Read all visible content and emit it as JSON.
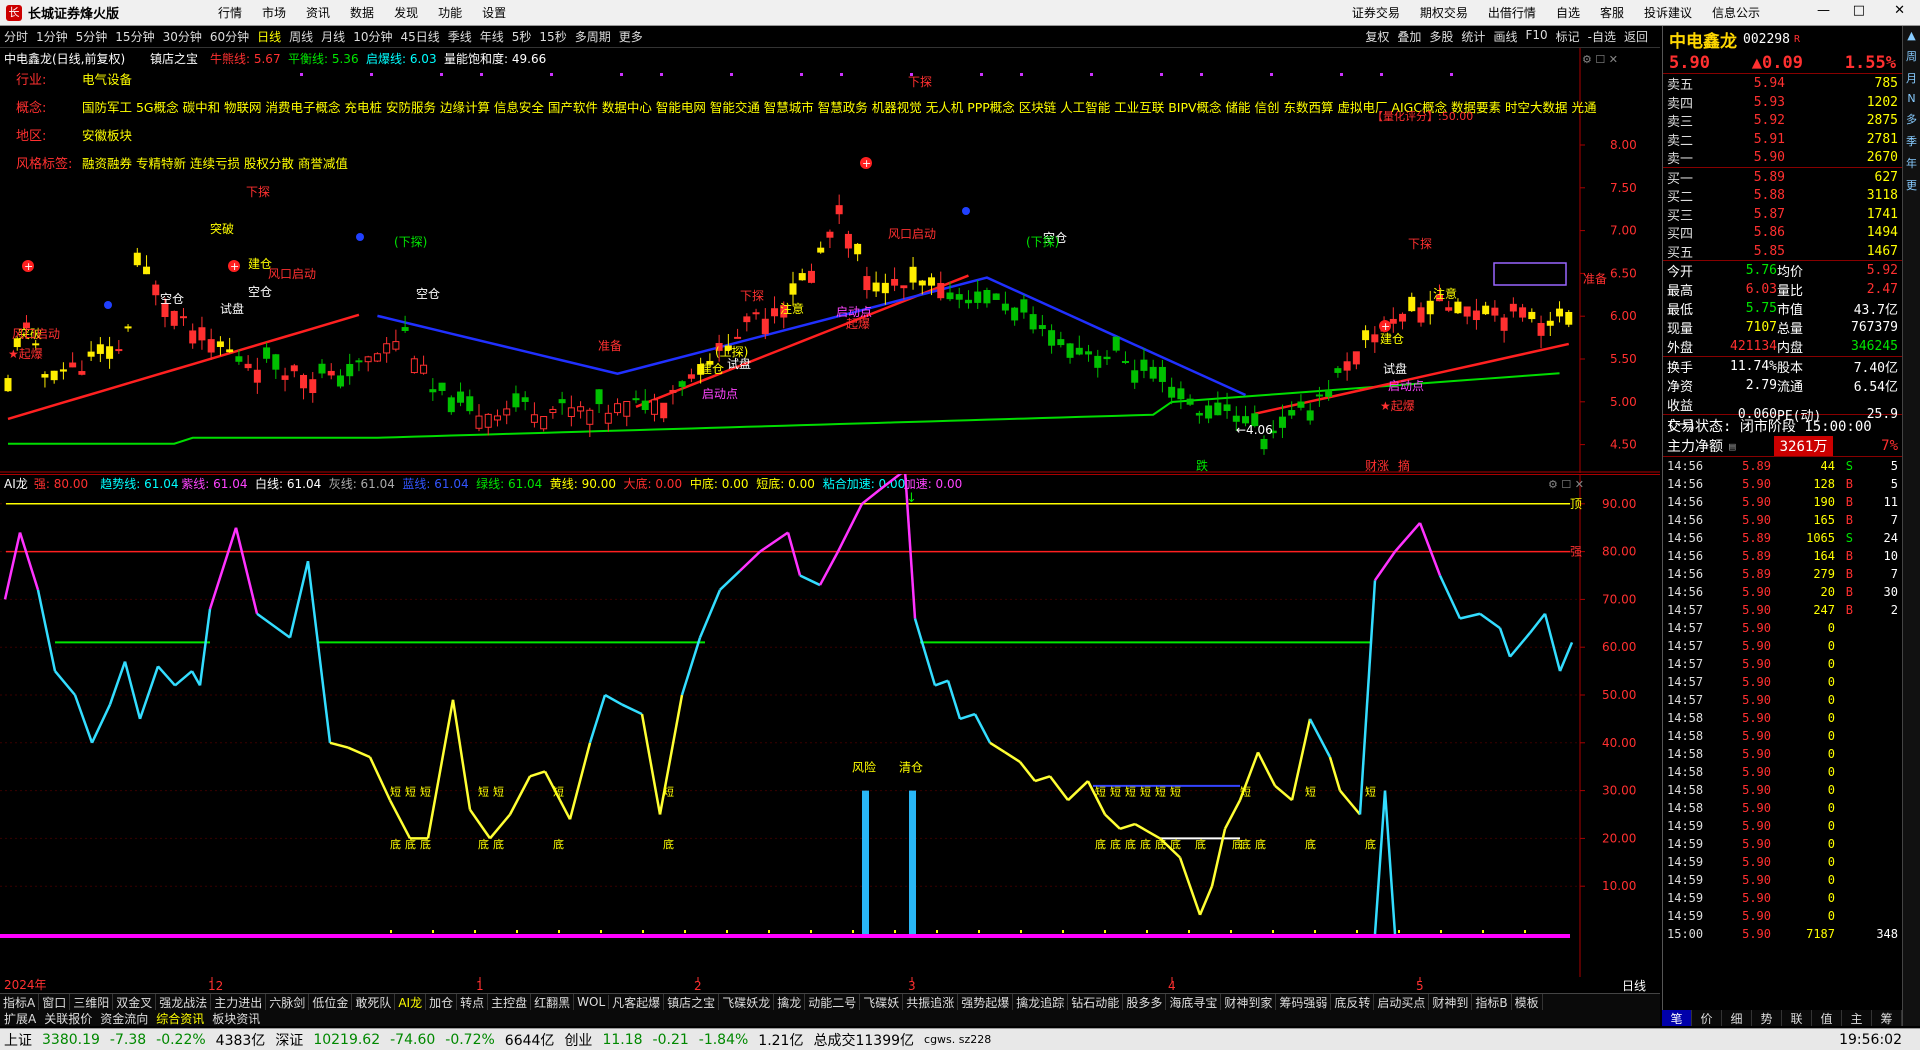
{
  "app": {
    "title": "长城证券烽火版",
    "menu": [
      "行情",
      "市场",
      "资讯",
      "数据",
      "发现",
      "功能",
      "设置"
    ],
    "right_menu": [
      "证券交易",
      "期权交易",
      "出借行情",
      "自选",
      "客服",
      "投诉建议",
      "信息公示"
    ]
  },
  "toolbar": {
    "periods": [
      "分时",
      "1分钟",
      "5分钟",
      "15分钟",
      "30分钟",
      "60分钟",
      "日线",
      "周线",
      "月线",
      "10分钟",
      "45日线",
      "季线",
      "年线",
      "5秒",
      "15秒",
      "多周期",
      "更多"
    ],
    "active": "日线",
    "right": [
      "复权",
      "叠加",
      "多股",
      "统计",
      "画线",
      "F10",
      "标记",
      "-自选",
      "返回"
    ]
  },
  "main_chart": {
    "header": {
      "name": "中电鑫龙(日线,前复权)",
      "indicator": "镇店之宝",
      "items": [
        {
          "t": "牛熊线: 5.67",
          "c": "#ff3030"
        },
        {
          "t": "平衡线: 5.36",
          "c": "#00e600"
        },
        {
          "t": "启爆线: 6.03",
          "c": "#00ffff"
        },
        {
          "t": "量能饱和度: 49.66",
          "c": "#ffffff"
        }
      ]
    },
    "info": [
      {
        "k": "行业:",
        "v": "电气设备"
      },
      {
        "k": "概念:",
        "v": "国防军工 5G概念 碳中和 物联网 消费电子概念 充电桩 安防服务 边缘计算 信息安全 国产软件 数据中心 智能电网 智能交通 智慧城市 智慧政务 机器视觉 无人机 PPP概念 区块链 人工智能 工业互联 BIPV概念 储能 信创 东数西算 虚拟电厂 AIGC概念 数据要素 时空大数据 光通"
      },
      {
        "k": "地区:",
        "v": "安徽板块"
      },
      {
        "k": "风格标签:",
        "v": "融资融券 专精特新 连续亏损 股权分散 商誉减值"
      }
    ],
    "y_ticks": [
      "8.00",
      "7.50",
      "7.00",
      "6.50",
      "6.00",
      "5.50",
      "5.00",
      "4.50",
      "4.00"
    ],
    "labels": {
      "low": "←4.06",
      "quant": "【量化评分】:50.00",
      "tags": [
        "跌",
        "财涨",
        "摘"
      ]
    },
    "markers": {
      "shikai": "空仓",
      "shipan": "试盘",
      "tupo": "突破",
      "xiatan": "下探",
      "jiancang": "建仓",
      "fengkou": "风口启动",
      "zhuyi": "注意",
      "qidong": "启动点",
      "shangtan": "(上探)",
      "xiatan2": "(下探)",
      "zhunbei": "准备",
      "qibao": "起爆",
      "qidian": "★起爆"
    }
  },
  "ai_chart": {
    "header": [
      {
        "t": "AI龙",
        "c": "#ffffff"
      },
      {
        "t": "强: 80.00",
        "c": "#ff3030"
      },
      {
        "t": "趋势线: 61.04",
        "c": "#00ffff"
      },
      {
        "t": "紫线: 61.04",
        "c": "#ff44ff"
      },
      {
        "t": "白线: 61.04",
        "c": "#ffffff"
      },
      {
        "t": "灰线: 61.04",
        "c": "#aaaaaa"
      },
      {
        "t": "蓝线: 61.04",
        "c": "#3355ff"
      },
      {
        "t": "绿线: 61.04",
        "c": "#00e600"
      },
      {
        "t": "黄线: 90.00",
        "c": "#ffff00"
      },
      {
        "t": "大底: 0.00",
        "c": "#ff3030"
      },
      {
        "t": "中底: 0.00",
        "c": "#ffff00"
      },
      {
        "t": "短底: 0.00",
        "c": "#ffff00"
      },
      {
        "t": "粘合加速: 0.00",
        "c": "#00ffff"
      },
      {
        "t": "加速: 0.00",
        "c": "#ff44ff"
      }
    ],
    "y_ticks": [
      "90.00",
      "80.00",
      "70.00",
      "60.00",
      "50.00",
      "40.00",
      "30.00",
      "20.00",
      "10.00"
    ],
    "line_labels": {
      "top": "顶",
      "strong": "强"
    },
    "events": {
      "risk": "风险",
      "clear": "清仓"
    },
    "di": "底",
    "duan": "短"
  },
  "x_axis": {
    "year": "2024年",
    "months": [
      "12",
      "1",
      "2",
      "3",
      "4",
      "5"
    ],
    "period": "日线"
  },
  "bottom_tabs": [
    "指标A",
    "窗口",
    "三维阳",
    "双金叉",
    "强龙战法",
    "主力进出",
    "六脉剑",
    "低位金",
    "敢死队",
    "AI龙",
    "加仓",
    "转点",
    "主控盘",
    "红翻黑",
    "WOL",
    "凡客起爆",
    "镇店之宝",
    "飞碟妖龙",
    "擒龙",
    "动能二号",
    "飞碟妖",
    "共振追涨",
    "强势起爆",
    "擒龙追踪",
    "钻石动能",
    "股多多",
    "海底寻宝",
    "财神到家",
    "筹码强弱",
    "底反转",
    "启动买点",
    "财神到",
    "指标B",
    "模板"
  ],
  "bottom_tabs_active": "AI龙",
  "bottom_tabs2": [
    "扩展A",
    "关联报价",
    "资金流向",
    "综合资讯",
    "板块资讯"
  ],
  "bottom_tabs2_active": "综合资讯",
  "quote": {
    "name": "中电鑫龙",
    "code": "002298",
    "flag": "R",
    "price": "5.90",
    "change": "▲0.09",
    "pct": "1.55%",
    "asks": [
      [
        "卖五",
        "5.94",
        "785"
      ],
      [
        "卖四",
        "5.93",
        "1202"
      ],
      [
        "卖三",
        "5.92",
        "2875"
      ],
      [
        "卖二",
        "5.91",
        "2781"
      ],
      [
        "卖一",
        "5.90",
        "2670"
      ]
    ],
    "bids": [
      [
        "买一",
        "5.89",
        "627"
      ],
      [
        "买二",
        "5.88",
        "3118"
      ],
      [
        "买三",
        "5.87",
        "1741"
      ],
      [
        "买四",
        "5.86",
        "1494"
      ],
      [
        "买五",
        "5.85",
        "1467"
      ]
    ],
    "stats": [
      [
        "今开",
        "5.76",
        "均价",
        "5.92"
      ],
      [
        "最高",
        "6.03",
        "量比",
        "2.47"
      ],
      [
        "最低",
        "5.75",
        "市值",
        "43.7亿"
      ],
      [
        "现量",
        "7107",
        "总量",
        "767379"
      ],
      [
        "外盘",
        "421134",
        "内盘",
        "346245"
      ]
    ],
    "stats2": [
      [
        "换手",
        "11.74%",
        "股本",
        "7.40亿"
      ],
      [
        "净资",
        "2.79",
        "流通",
        "6.54亿"
      ],
      [
        "收益(一)",
        "0.060",
        "PE(动)",
        "25.9"
      ]
    ],
    "trade_status": "交易状态: 闭市阶段 15:00:00",
    "net_inflow": {
      "label": "主力净额",
      "value": "3261万",
      "pct": "7%"
    },
    "ticks": [
      [
        "14:56",
        "5.89",
        "44",
        "S",
        "5"
      ],
      [
        "14:56",
        "5.90",
        "128",
        "B",
        "5"
      ],
      [
        "14:56",
        "5.90",
        "190",
        "B",
        "11"
      ],
      [
        "14:56",
        "5.90",
        "165",
        "B",
        "7"
      ],
      [
        "14:56",
        "5.89",
        "1065",
        "S",
        "24"
      ],
      [
        "14:56",
        "5.89",
        "164",
        "B",
        "10"
      ],
      [
        "14:56",
        "5.89",
        "279",
        "B",
        "7"
      ],
      [
        "14:56",
        "5.90",
        "20",
        "B",
        "30"
      ],
      [
        "14:57",
        "5.90",
        "247",
        "B",
        "2"
      ],
      [
        "14:57",
        "5.90",
        "0",
        "",
        ""
      ],
      [
        "14:57",
        "5.90",
        "0",
        "",
        ""
      ],
      [
        "14:57",
        "5.90",
        "0",
        "",
        ""
      ],
      [
        "14:57",
        "5.90",
        "0",
        "",
        ""
      ],
      [
        "14:57",
        "5.90",
        "0",
        "",
        ""
      ],
      [
        "14:58",
        "5.90",
        "0",
        "",
        ""
      ],
      [
        "14:58",
        "5.90",
        "0",
        "",
        ""
      ],
      [
        "14:58",
        "5.90",
        "0",
        "",
        ""
      ],
      [
        "14:58",
        "5.90",
        "0",
        "",
        ""
      ],
      [
        "14:58",
        "5.90",
        "0",
        "",
        ""
      ],
      [
        "14:58",
        "5.90",
        "0",
        "",
        ""
      ],
      [
        "14:59",
        "5.90",
        "0",
        "",
        ""
      ],
      [
        "14:59",
        "5.90",
        "0",
        "",
        ""
      ],
      [
        "14:59",
        "5.90",
        "0",
        "",
        ""
      ],
      [
        "14:59",
        "5.90",
        "0",
        "",
        ""
      ],
      [
        "14:59",
        "5.90",
        "0",
        "",
        ""
      ],
      [
        "14:59",
        "5.90",
        "0",
        "",
        ""
      ],
      [
        "15:00",
        "5.90",
        "7187",
        "",
        "348"
      ]
    ],
    "bottom": [
      "笔",
      "价",
      "细",
      "势",
      "联",
      "值",
      "主",
      "筹"
    ]
  },
  "side_strip": [
    "周",
    "月",
    "N",
    "多",
    "季",
    "年",
    "更"
  ],
  "status": {
    "sh": "上证",
    "sh_v": "3380.19",
    "sh_c": "-7.38",
    "sh_p": "-0.22%",
    "sh_a": "4383亿",
    "sz": "深证",
    "sz_v": "10219.62",
    "sz_c": "-74.60",
    "sz_p": "-0.72%",
    "sz_a": "6644亿",
    "cy": "创业",
    "cy_v": "11.18",
    "cy_c": "-0.21",
    "cy_p": "-1.84%",
    "cy_a": "1.21亿",
    "total": "总成交11399亿",
    "srv": "cgws. sz228",
    "time": "19:56:02"
  }
}
